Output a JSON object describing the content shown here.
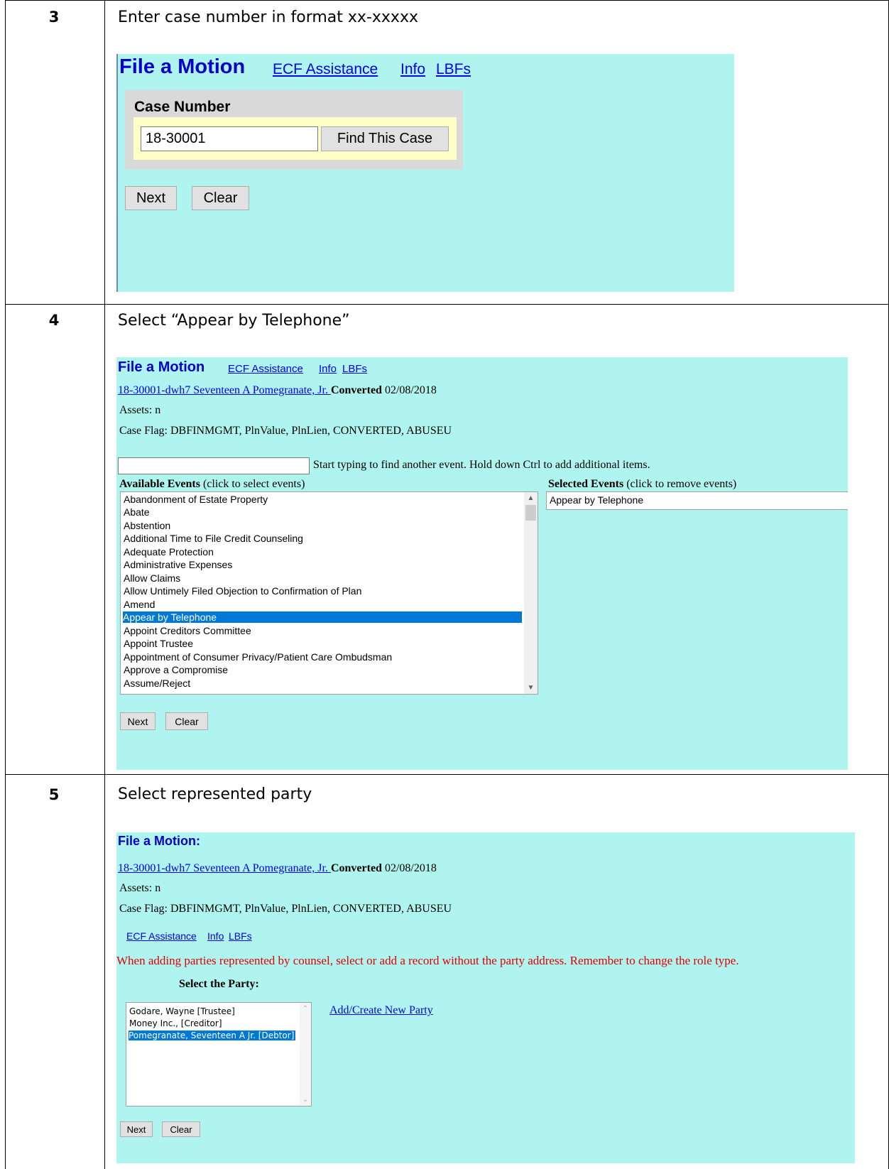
{
  "steps": [
    {
      "number": "3",
      "instruction": "Enter case number in format xx-xxxxx",
      "panel": {
        "title": "File a Motion",
        "links": [
          "ECF Assistance",
          "Info",
          "LBFs"
        ],
        "case_number_label": "Case Number",
        "case_number_value": "18-30001",
        "find_button": "Find This Case",
        "next_button": "Next",
        "clear_button": "Clear"
      }
    },
    {
      "number": "4",
      "instruction": "Select “Appear by Telephone”",
      "panel": {
        "title": "File a Motion",
        "links": [
          "ECF Assistance",
          "Info",
          "LBFs"
        ],
        "case_link": "18-30001-dwh7 Seventeen A Pomegranate, Jr. ",
        "case_status": "Converted",
        "case_date": "02/08/2018",
        "assets": "Assets: n",
        "case_flag": "Case Flag: DBFINMGMT, PlnValue, PlnLien, CONVERTED, ABUSEU",
        "search_value": "",
        "search_hint": "Start typing to find another event. Hold down Ctrl to add additional items.",
        "available_label": "Available Events",
        "available_hint": "(click to select events)",
        "selected_label": "Selected Events",
        "selected_hint": "(click to remove events)",
        "available_events": [
          "Abandonment of Estate Property",
          "Abate",
          "Abstention",
          "Additional Time to File Credit Counseling",
          "Adequate Protection",
          "Administrative Expenses",
          "Allow Claims",
          "Allow Untimely Filed Objection to Confirmation of Plan",
          "Amend",
          "Appear by Telephone",
          "Appoint Creditors Committee",
          "Appoint Trustee",
          "Appointment of Consumer Privacy/Patient Care Ombudsman",
          "Approve a Compromise",
          "Assume/Reject"
        ],
        "selected_events": [
          "Appear by Telephone"
        ],
        "next_button": "Next",
        "clear_button": "Clear"
      }
    },
    {
      "number": "5",
      "instruction": "Select represented party",
      "panel": {
        "title": "File a Motion:",
        "case_link": "18-30001-dwh7 Seventeen A Pomegranate, Jr. ",
        "case_status": "Converted",
        "case_date": "02/08/2018",
        "assets": "Assets: n",
        "case_flag": "Case Flag: DBFINMGMT, PlnValue, PlnLien, CONVERTED, ABUSEU",
        "links": [
          "ECF Assistance",
          "Info",
          "LBFs"
        ],
        "warning": "When adding parties represented by counsel, select or add a record without the party address. Remember to change the role type.",
        "select_party_label": "Select the Party:",
        "parties": [
          "Godare, Wayne [Trustee]",
          "Money Inc., [Creditor]",
          "Pomegranate, Seventeen A Jr. [Debtor]"
        ],
        "add_party_link": "Add/Create New Party",
        "next_button": "Next",
        "clear_button": "Clear"
      }
    }
  ],
  "colors": {
    "panel_bg": "#aff4ef",
    "title_blue": "#0000cc",
    "link_blue": "#0000ee",
    "selection_blue": "#0078d7",
    "warning_red": "#e00000",
    "case_box_gray": "#d9d9d9",
    "case_box_yellow": "#ffffc8"
  }
}
